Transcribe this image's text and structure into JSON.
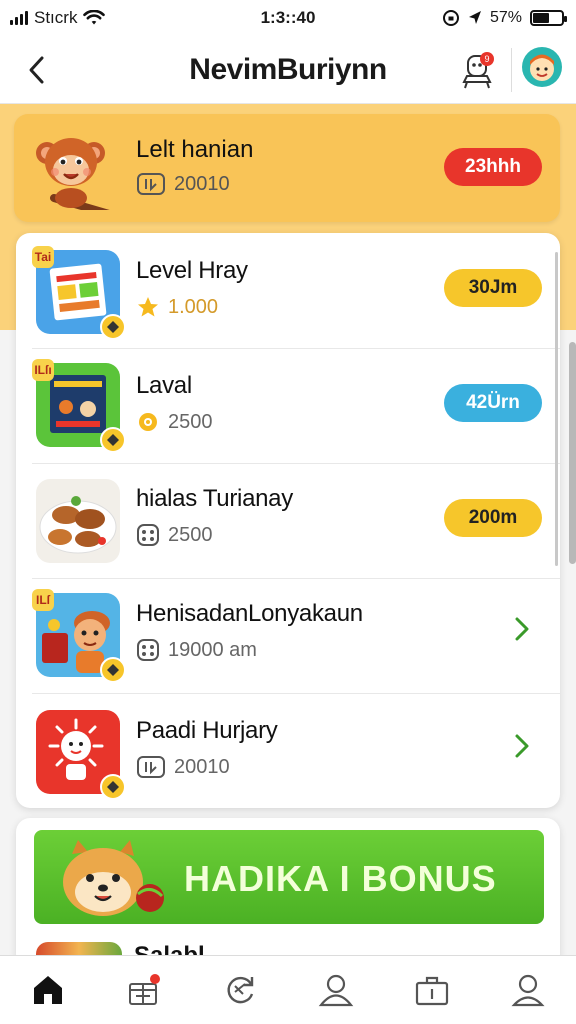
{
  "status_bar": {
    "carrier": "Stıcrk",
    "time": "1:3::40",
    "battery": "57%",
    "battery_level": 0.57
  },
  "header": {
    "title": "NevimBuriynn",
    "notification_badge": "9"
  },
  "featured": {
    "title": "Lelt hanian",
    "count": "20010",
    "pill": "23hhh",
    "pill_color": "#e8352b"
  },
  "items": [
    {
      "title": "Level Hray",
      "count": "1.000",
      "sub_icon": "star-icon",
      "pill": "30Jm",
      "pill_color": "#f6c62b",
      "thumb_tag": "Tai"
    },
    {
      "title": "Laval",
      "count": "2500",
      "sub_icon": "gear-icon",
      "pill": "42Ürn",
      "pill_color": "#3ab0de",
      "thumb_tag": "ILſı"
    },
    {
      "title": "hialas Turianay",
      "count": "2500",
      "sub_icon": "dice-icon",
      "pill": "200m",
      "pill_color": "#f6c62b",
      "thumb_tag": ""
    },
    {
      "title": "HenisadanLonyakaun",
      "count": "19000 am",
      "sub_icon": "dice-icon",
      "pill": "",
      "pill_color": "",
      "thumb_tag": "ILſ"
    },
    {
      "title": "Paadi Hurjary",
      "count": "20010",
      "sub_icon": "counter-icon",
      "pill": "",
      "pill_color": "",
      "thumb_tag": ""
    }
  ],
  "bonus": {
    "label": "HADIKA I BONUS",
    "peek_label": "Salabl"
  },
  "tabs": [
    "home-icon",
    "gift-icon",
    "refresh-icon",
    "profile-icon",
    "bag-icon",
    "account-icon"
  ],
  "colors": {
    "accent_orange": "#f9c457",
    "accent_green": "#4bb124",
    "chevron_green": "#3a9a2a"
  }
}
